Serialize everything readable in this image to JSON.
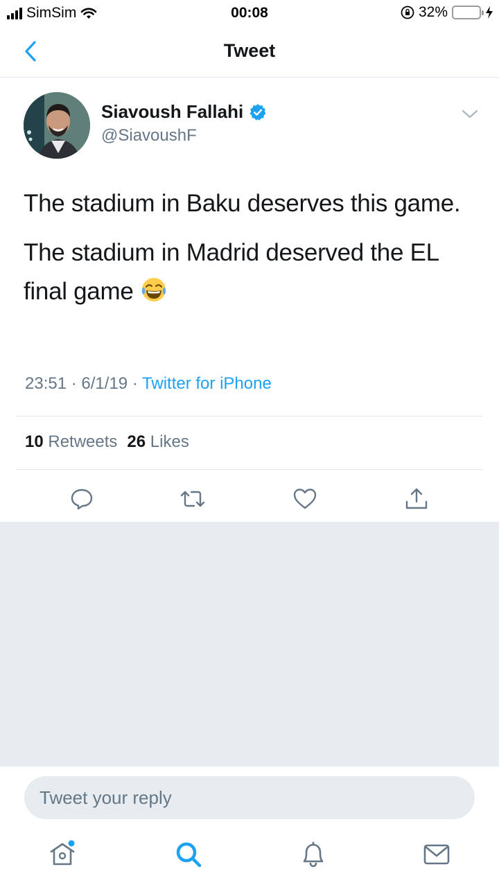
{
  "status_bar": {
    "carrier": "SimSim",
    "time": "00:08",
    "battery_percent": "32%"
  },
  "nav": {
    "title": "Tweet"
  },
  "tweet": {
    "author_name": "Siavoush Fallahi",
    "author_handle": "@SiavoushF",
    "paragraph1": "The stadium in Baku deserves this game.",
    "paragraph2": "The stadium in Madrid deserved the EL final game",
    "time": "23:51",
    "date": "6/1/19",
    "separator": "·",
    "source": "Twitter for iPhone",
    "retweets_count": "10",
    "retweets_label": "Retweets",
    "likes_count": "26",
    "likes_label": "Likes"
  },
  "reply": {
    "placeholder": "Tweet your reply"
  },
  "colors": {
    "twitter_blue": "#1da1f2",
    "secondary_text": "#657786",
    "background_gray": "#e6ecf0",
    "battery_yellow": "#f5c400"
  },
  "icons": {
    "back": "chevron-left-icon",
    "verified": "verified-badge-icon",
    "caret": "chevron-down-icon",
    "reply": "reply-bubble-icon",
    "retweet": "retweet-icon",
    "like": "heart-icon",
    "share": "share-icon",
    "home": "home-icon",
    "search": "search-icon",
    "notifications": "bell-icon",
    "messages": "envelope-icon"
  }
}
